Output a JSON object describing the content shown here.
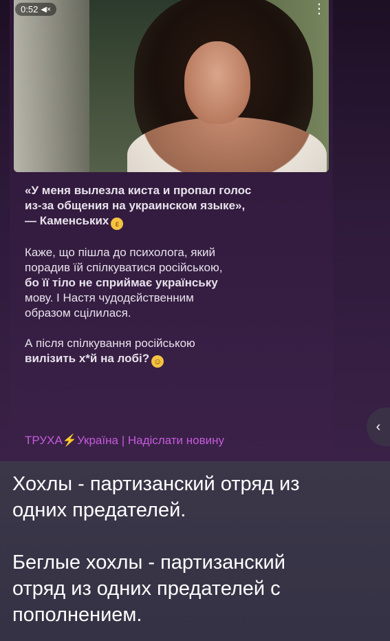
{
  "video": {
    "duration": "0:52",
    "mute_icon": "speaker-muted-icon",
    "more_icon": "vertical-dots-icon"
  },
  "post": {
    "para1_line1": "«У меня вылезла киста и пропал голос",
    "para1_line2": "из-за общения на украинском языке»,",
    "para1_line3": "— Каменських",
    "para2_line1": "Каже, що пішла до психолога, який",
    "para2_line2": "порадив їй спілкуватися російською,",
    "para2_line3": "бо її тіло не сприймає українську",
    "para2_line4": "мову. І Настя чудодєйственним",
    "para2_line5": "образом сцілилася.",
    "para3_line1": "А після спілкування російською",
    "para3_line2": "вилізить х*й на лобі?",
    "footer_brand": "ТРУХА",
    "footer_country": "Україна",
    "footer_sep": "|",
    "footer_action": "Надіслати новину"
  },
  "side_arrow": "‹",
  "comment": {
    "line1": "Хохлы - партизанский отряд из",
    "line2": "одних предателей.",
    "line3": "Беглые хохлы - партизанский",
    "line4": "отряд из одних предателей с",
    "line5": "пополнением."
  },
  "colors": {
    "accent_link": "#c55bdc",
    "card_bg": "#3b2148",
    "comment_bg": "#3b3749"
  }
}
